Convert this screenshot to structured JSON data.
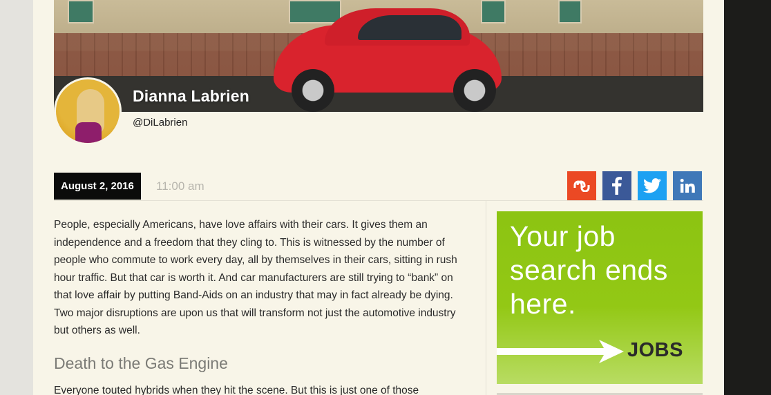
{
  "author": {
    "name": "Dianna Labrien",
    "handle": "@DiLabrien"
  },
  "post": {
    "date": "August 2, 2016",
    "time": "11:00 am"
  },
  "share": {
    "icons": [
      "stumbleupon-icon",
      "facebook-icon",
      "twitter-icon",
      "linkedin-icon"
    ],
    "colors": {
      "stumbleupon": "#eb4924",
      "facebook": "#3b5998",
      "twitter": "#1da1f2",
      "linkedin": "#3f78b8"
    }
  },
  "article": {
    "intro": "People, especially Americans, have love affairs with their cars. It gives them an independence and a freedom that they cling to. This is witnessed by the number of people who commute to work every day, all by themselves in their cars, sitting in rush hour traffic. But that car is worth it. And car manufacturers are still trying to “bank” on that love affair by putting Band-Aids on an industry that may in fact already be dying. Two major disruptions are upon us that will transform not just the automotive industry but others as well.",
    "subheading": "Death to the Gas Engine",
    "next_paragraph": "Everyone touted hybrids when they hit the scene. But this is just one of those"
  },
  "ad": {
    "headline": "Your job search ends here.",
    "cta": "JOBS",
    "color": "#8cc412"
  }
}
